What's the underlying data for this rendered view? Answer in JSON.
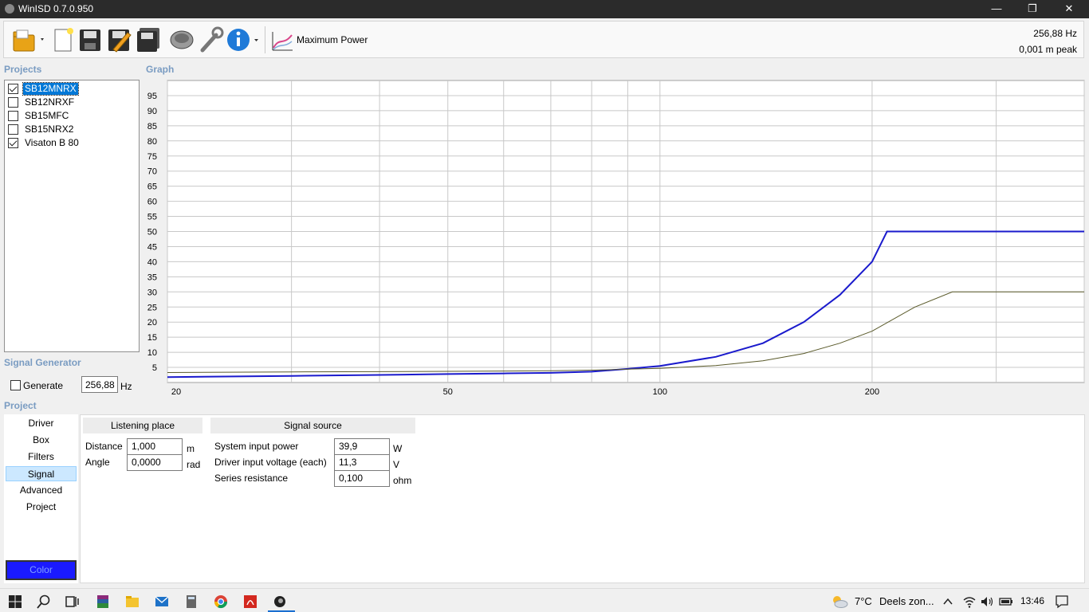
{
  "window": {
    "title": "WinISD 0.7.0.950"
  },
  "window_controls": {
    "minimize": "—",
    "restore": "❐",
    "close": "✕"
  },
  "toolbar": {
    "items": [
      "open-folder-icon",
      "new-project-icon",
      "save-icon",
      "save-edit-icon",
      "save-all-icon",
      "driver-icon",
      "tools-icon",
      "info-icon",
      "graph-type-icon"
    ],
    "graph_type_label": "Maximum Power",
    "readout_frequency": "256,88 Hz",
    "readout_value": "0,001 m peak"
  },
  "projects": {
    "label": "Projects",
    "items": [
      {
        "name": "SB12MNRX",
        "checked": true,
        "selected": true
      },
      {
        "name": "SB12NRXF",
        "checked": false,
        "selected": false
      },
      {
        "name": "SB15MFC",
        "checked": false,
        "selected": false
      },
      {
        "name": "SB15NRX2",
        "checked": false,
        "selected": false
      },
      {
        "name": "Visaton B 80",
        "checked": true,
        "selected": false
      }
    ]
  },
  "signal_generator": {
    "label": "Signal Generator",
    "generate_label": "Generate",
    "frequency_value": "256,88",
    "frequency_unit": "Hz"
  },
  "graph": {
    "label": "Graph",
    "y_ticks": [
      "95",
      "90",
      "85",
      "80",
      "75",
      "70",
      "65",
      "60",
      "55",
      "50",
      "45",
      "40",
      "35",
      "30",
      "25",
      "20",
      "15",
      "10",
      "5"
    ],
    "x_ticks": [
      "20",
      "50",
      "100",
      "200"
    ],
    "colors": {
      "series_1": "#1a1acc",
      "series_2": "#5a5a2a",
      "grid": "#c8c8c8"
    }
  },
  "chart_data": {
    "type": "line",
    "title": "",
    "xlabel": "",
    "ylabel": "",
    "x_scale": "log",
    "xlim": [
      20,
      400
    ],
    "ylim": [
      0,
      100
    ],
    "grid": true,
    "series": [
      {
        "color": "#1a1acc",
        "x": [
          20,
          30,
          40,
          50,
          60,
          70,
          80,
          90,
          100,
          120,
          140,
          160,
          180,
          200,
          210,
          250,
          300,
          400
        ],
        "y": [
          1.8,
          2.2,
          2.5,
          2.8,
          3.0,
          3.2,
          3.6,
          4.5,
          5.5,
          8.5,
          13,
          20,
          29,
          40,
          50,
          50,
          50,
          50
        ]
      },
      {
        "color": "#5a5a2a",
        "x": [
          20,
          30,
          40,
          50,
          60,
          70,
          80,
          90,
          100,
          120,
          140,
          160,
          180,
          200,
          230,
          260,
          300,
          400
        ],
        "y": [
          3.3,
          3.5,
          3.6,
          3.7,
          3.8,
          3.9,
          4.1,
          4.4,
          4.7,
          5.6,
          7.2,
          9.6,
          13,
          17,
          25,
          30,
          30,
          30
        ]
      }
    ]
  },
  "project": {
    "label": "Project",
    "nav": [
      "Driver",
      "Box",
      "Filters",
      "Signal",
      "Advanced",
      "Project"
    ],
    "nav_selected": "Signal",
    "color_label": "Color",
    "color_value": "#1a1aff"
  },
  "listening_place": {
    "title": "Listening place",
    "distance_label": "Distance",
    "distance_value": "1,000",
    "distance_unit": "m",
    "angle_label": "Angle",
    "angle_value": "0,0000",
    "angle_unit": "rad"
  },
  "signal_source": {
    "title": "Signal source",
    "power_label": "System input power",
    "power_value": "39,9",
    "power_unit": "W",
    "voltage_label": "Driver input voltage (each)",
    "voltage_value": "11,3",
    "voltage_unit": "V",
    "resistance_label": "Series resistance",
    "resistance_value": "0,100",
    "resistance_unit": "ohm"
  },
  "taskbar": {
    "apps": [
      "windows-start-icon",
      "search-icon",
      "task-view-icon",
      "winrar-icon",
      "file-explorer-icon",
      "mail-icon",
      "calculator-icon",
      "chrome-icon",
      "pdf-reader-icon",
      "winisd-icon"
    ],
    "weather_temp": "7°C",
    "weather_desc": "Deels zon...",
    "time": "13:46"
  }
}
